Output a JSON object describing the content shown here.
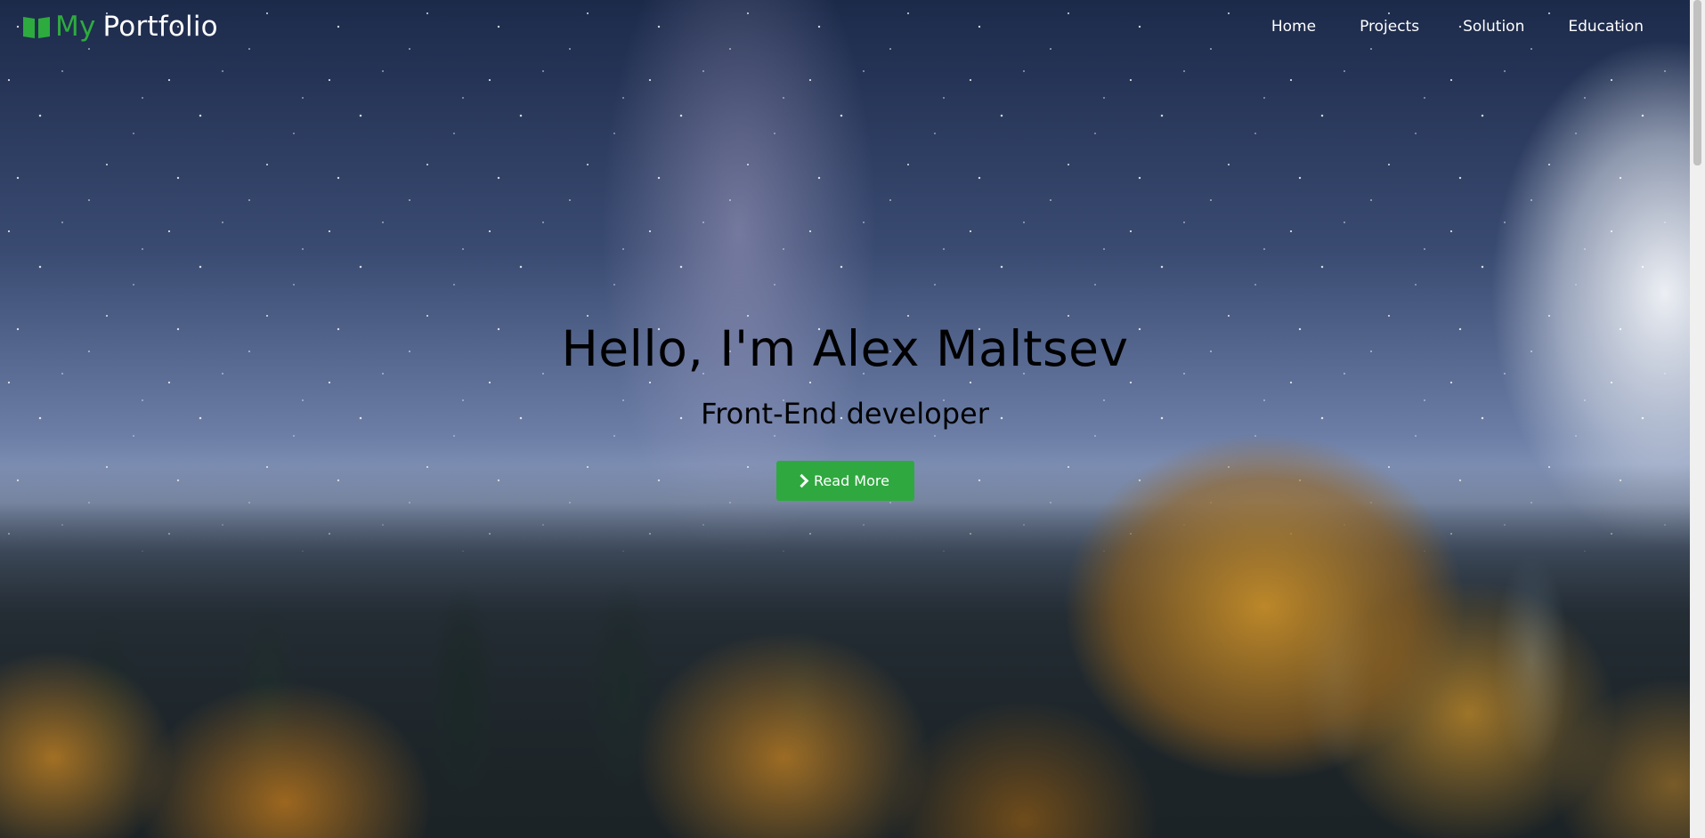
{
  "brand": {
    "my": "My",
    "portfolio": "Portfolio",
    "icon": "open-book-icon"
  },
  "nav": {
    "items": [
      "Home",
      "Projects",
      "Solution",
      "Education"
    ]
  },
  "hero": {
    "title": "Hello, I'm Alex Maltsev",
    "subtitle": "Front-End developer",
    "button_label": "Read More",
    "button_icon": "chevron-right-icon"
  },
  "colors": {
    "accent": "#2fa83f",
    "brand_green": "#2eab3f",
    "text_dark": "#000000",
    "nav_text": "#ffffff"
  }
}
